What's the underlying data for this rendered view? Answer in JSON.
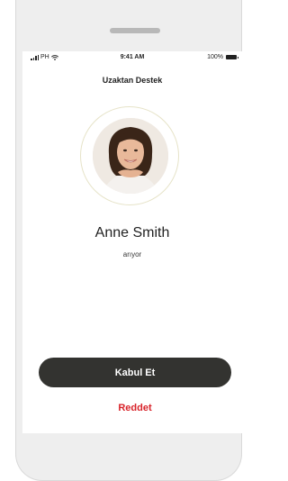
{
  "status_bar": {
    "carrier": "PH",
    "time": "9:41 AM",
    "battery": "100%"
  },
  "header": {
    "title": "Uzaktan Destek"
  },
  "caller": {
    "name": "Anne Smith",
    "status": "arıyor"
  },
  "actions": {
    "accept_label": "Kabul Et",
    "reject_label": "Reddet"
  },
  "colors": {
    "accept_bg": "#333330",
    "reject_text": "#d8232a",
    "ring": "#e6e3c8"
  },
  "icons": [
    "signal-icon",
    "wifi-icon",
    "battery-icon"
  ]
}
